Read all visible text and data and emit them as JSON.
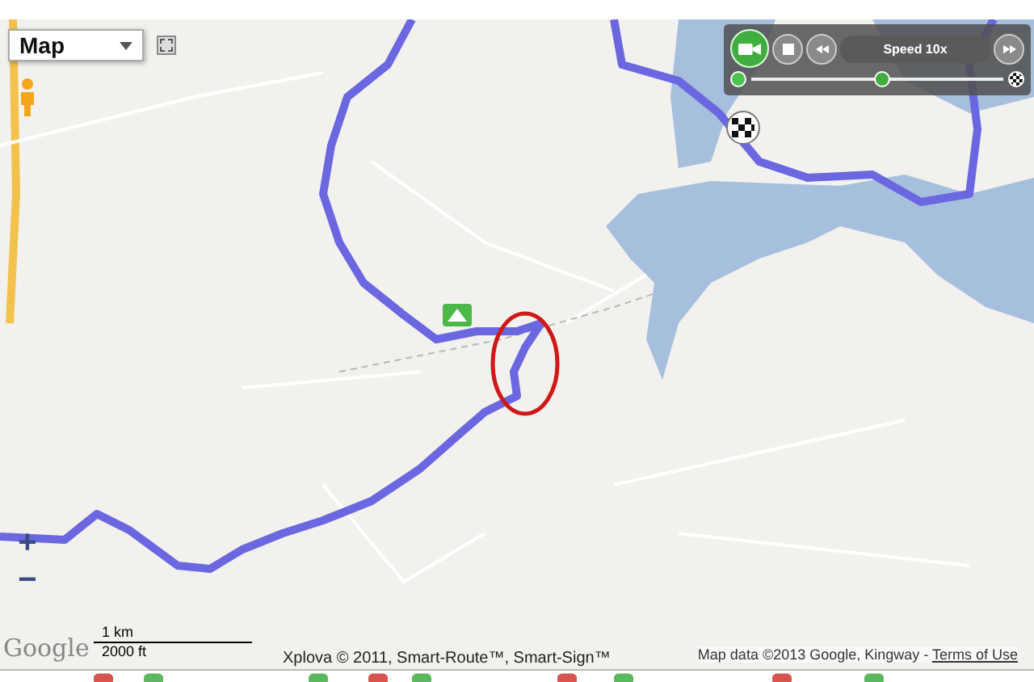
{
  "map_type": {
    "label": "Map"
  },
  "playback": {
    "speed_label": "Speed 10x",
    "level": 0.52
  },
  "zoom": {
    "zoom_in": "+",
    "zoom_out": "−"
  },
  "scale": {
    "metric": "1 km",
    "imperial": "2000 ft"
  },
  "logo": "Google",
  "credits": "Xplova © 2011, Smart-Route™, Smart-Sign™",
  "map_data": {
    "text": "Map data ©2013 Google, Kingway - ",
    "terms_link": "Terms of Use"
  }
}
